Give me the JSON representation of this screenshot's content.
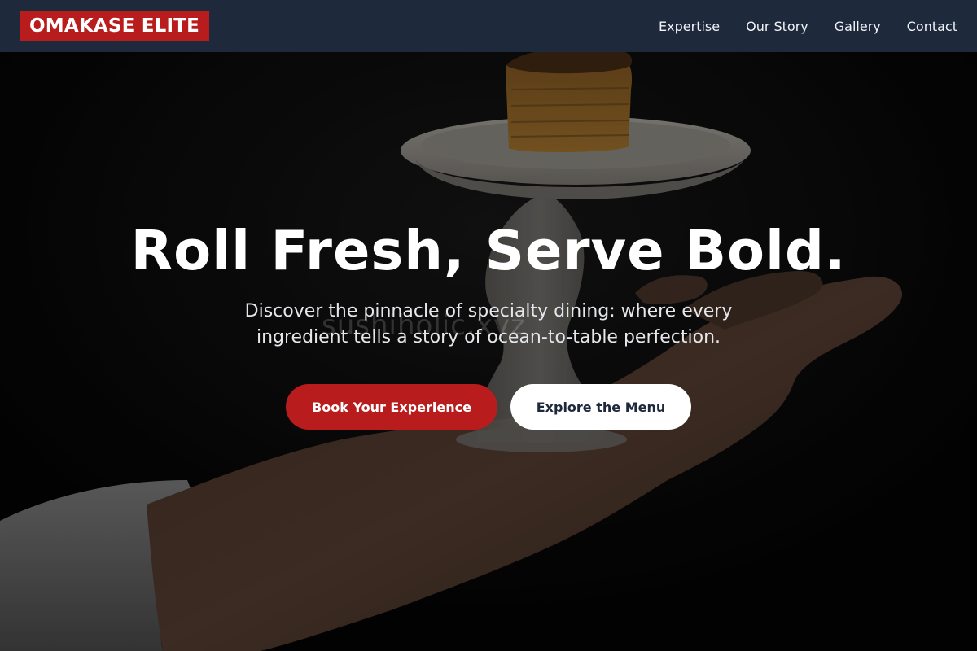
{
  "brand": {
    "logo_text": "OMAKASE ELITE",
    "accent_color": "#b91c1c",
    "nav_background": "#1e293b"
  },
  "nav": {
    "items": [
      {
        "label": "Expertise"
      },
      {
        "label": "Our Story"
      },
      {
        "label": "Gallery"
      },
      {
        "label": "Contact"
      }
    ]
  },
  "hero": {
    "title": "Roll Fresh, Serve Bold.",
    "subtitle": "Discover the pinnacle of specialty dining: where every ingredient tells a story of ocean-to-table perfection.",
    "watermark": "sushiholic.xyz",
    "primary_button": "Book Your Experience",
    "secondary_button": "Explore the Menu",
    "background_description_icon": "hand-holding-dish-photo"
  }
}
